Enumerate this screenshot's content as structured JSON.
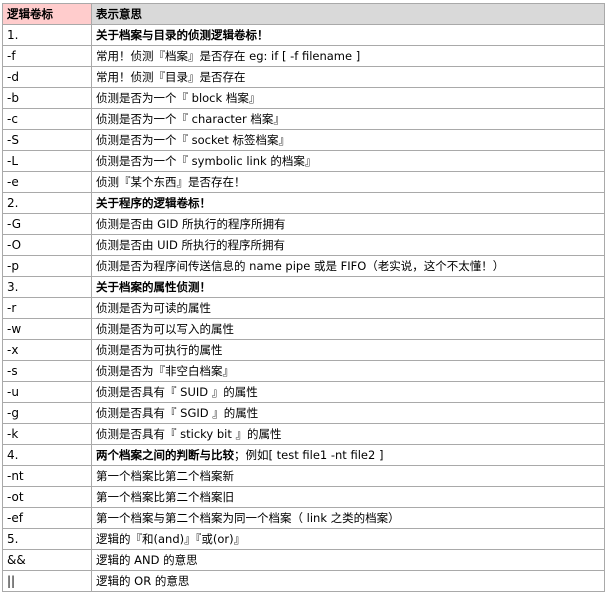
{
  "table": {
    "headers": [
      "逻辑卷标",
      "表示意思"
    ],
    "rows": [
      {
        "op": "1.",
        "desc": "关于档案与目录的侦测逻辑卷标！",
        "section": true
      },
      {
        "op": "-f",
        "desc": "常用！侦测『档案』是否存在 eg: if [ -f filename ]"
      },
      {
        "op": "-d",
        "desc": "常用！侦测『目录』是否存在"
      },
      {
        "op": "-b",
        "desc": "侦测是否为一个『 block 档案』"
      },
      {
        "op": "-c",
        "desc": "侦测是否为一个『 character 档案』"
      },
      {
        "op": "-S",
        "desc": "侦测是否为一个『 socket 标签档案』"
      },
      {
        "op": "-L",
        "desc": "侦测是否为一个『 symbolic link 的档案』"
      },
      {
        "op": "-e",
        "desc": "侦测『某个东西』是否存在！"
      },
      {
        "op": "2.",
        "desc": "关于程序的逻辑卷标！",
        "section": true
      },
      {
        "op": "-G",
        "desc": "侦测是否由 GID 所执行的程序所拥有"
      },
      {
        "op": "-O",
        "desc": "侦测是否由 UID 所执行的程序所拥有"
      },
      {
        "op": "-p",
        "desc": "侦测是否为程序间传送信息的 name pipe 或是 FIFO（老实说，这个不太懂！）"
      },
      {
        "op": "3.",
        "desc": "关于档案的属性侦测！",
        "section": true
      },
      {
        "op": "-r",
        "desc": "侦测是否为可读的属性"
      },
      {
        "op": "-w",
        "desc": "侦测是否为可以写入的属性"
      },
      {
        "op": "-x",
        "desc": "侦测是否为可执行的属性"
      },
      {
        "op": "-s",
        "desc": "侦测是否为『非空白档案』"
      },
      {
        "op": "-u",
        "desc": "侦测是否具有『 SUID 』的属性"
      },
      {
        "op": "-g",
        "desc": "侦测是否具有『 SGID 』的属性"
      },
      {
        "op": "-k",
        "desc": "侦测是否具有『 sticky bit 』的属性"
      },
      {
        "op": "4.",
        "desc_bold": "两个档案之间的判断与比较",
        "desc_rest": "；例如[ test file1 -nt file2 ]",
        "section": true
      },
      {
        "op": "-nt",
        "desc": "第一个档案比第二个档案新"
      },
      {
        "op": "-ot",
        "desc": "第一个档案比第二个档案旧"
      },
      {
        "op": "-ef",
        "desc": "第一个档案与第二个档案为同一个档案（ link 之类的档案）"
      },
      {
        "op": "5.",
        "desc": "逻辑的『和(and)』『或(or)』"
      },
      {
        "op": "&&",
        "desc": "逻辑的 AND 的意思"
      },
      {
        "op": "||",
        "desc": "逻辑的 OR 的意思"
      }
    ]
  }
}
